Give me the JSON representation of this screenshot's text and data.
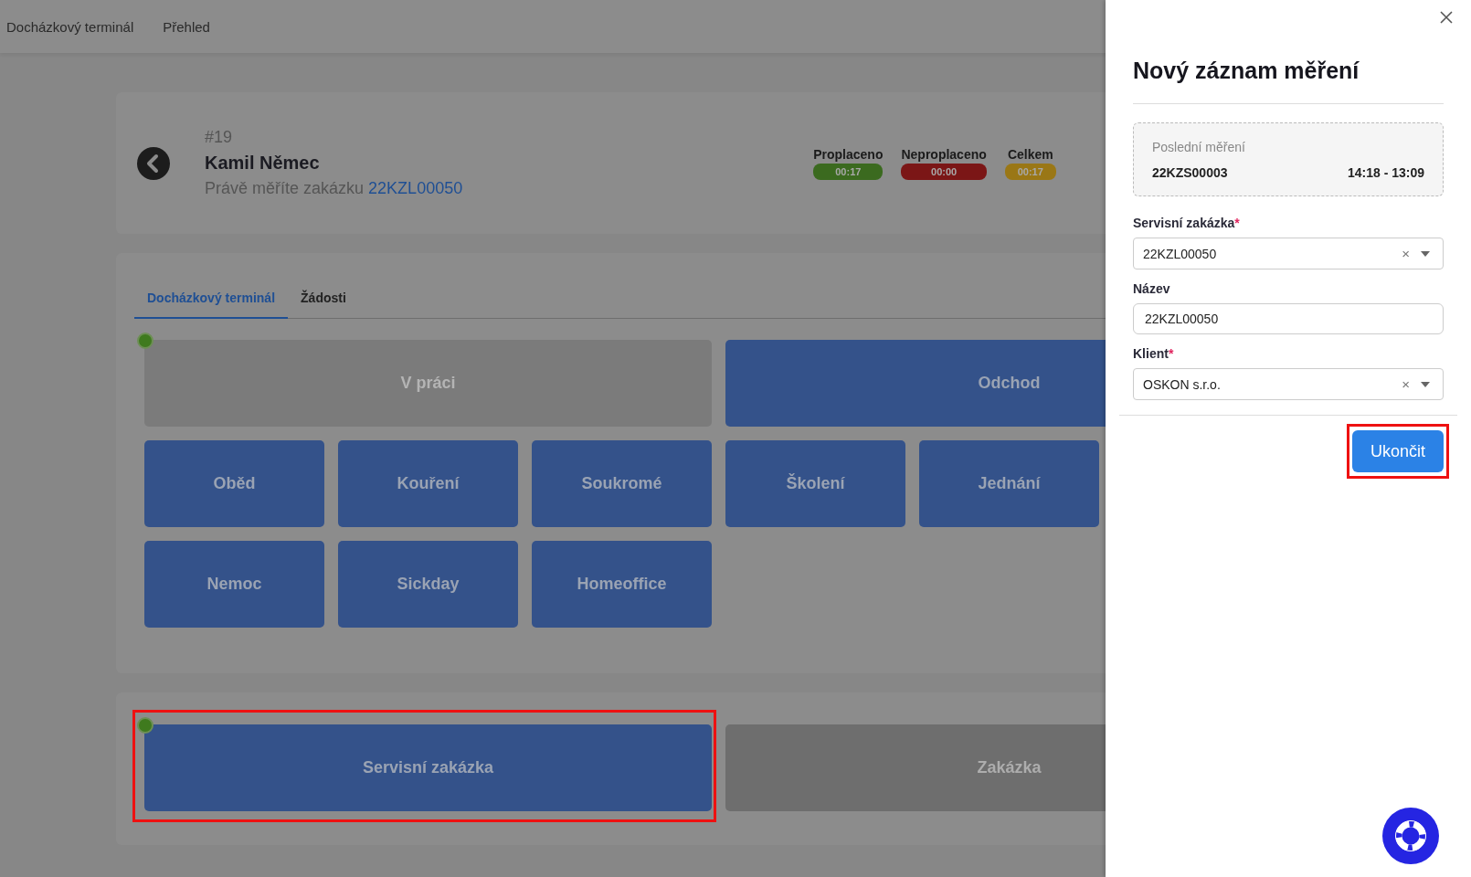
{
  "topnav": {
    "items": [
      {
        "label": "Docházkový terminál"
      },
      {
        "label": "Přehled"
      }
    ]
  },
  "header": {
    "number": "#19",
    "name": "Kamil Němec",
    "subtitle": "Právě měříte zakázku",
    "job_link": "22KZL00050",
    "stats": [
      {
        "label": "Proplaceno",
        "value": "00:17",
        "color": "#3b6a1f"
      },
      {
        "label": "Neproplaceno",
        "value": "00:00",
        "color": "#7b1616"
      },
      {
        "label": "Celkem",
        "value": "00:17",
        "color": "#9a7716"
      }
    ]
  },
  "tabs": [
    {
      "label": "Docházkový terminál",
      "selected": true
    },
    {
      "label": "Žádosti",
      "selected": false
    }
  ],
  "main_buttons": [
    {
      "label": "V práci",
      "disabled": true,
      "active": true
    },
    {
      "label": "Odchod",
      "disabled": false,
      "active": false
    }
  ],
  "attendance_buttons": [
    {
      "label": "Oběd",
      "disabled": false,
      "active": false
    },
    {
      "label": "Kouření",
      "disabled": false,
      "active": false
    },
    {
      "label": "Soukromé",
      "disabled": false,
      "active": false
    },
    {
      "label": "Školení",
      "disabled": false,
      "active": false
    },
    {
      "label": "Jednání",
      "disabled": false,
      "active": false
    },
    {
      "label": "Nemoc",
      "disabled": false,
      "active": false
    },
    {
      "label": "Sickday",
      "disabled": false,
      "active": false
    },
    {
      "label": "Homeoffice",
      "disabled": false,
      "active": false
    }
  ],
  "job_buttons": [
    {
      "label": "Servisní zakázka",
      "disabled": false,
      "active": true,
      "highlighted": true
    },
    {
      "label": "Zakázka",
      "disabled": true,
      "active": false,
      "highlighted": false
    }
  ],
  "drawer": {
    "title": "Nový záznam měření",
    "last_measurement": {
      "label": "Poslední měření",
      "job": "22KZS00003",
      "time": "14:18 - 13:09"
    },
    "fields": [
      {
        "kind": "select",
        "label": "Servisní zakázka",
        "required_mark": "*",
        "value": "22KZL00050",
        "clear": "×"
      },
      {
        "kind": "text",
        "label": "Název",
        "value": "22KZL00050"
      },
      {
        "kind": "select",
        "label": "Klient",
        "required_mark": "*",
        "value": "OSKON s.r.o.",
        "clear": "×"
      }
    ],
    "submit": {
      "label": "Ukončit",
      "highlighted": true
    }
  }
}
